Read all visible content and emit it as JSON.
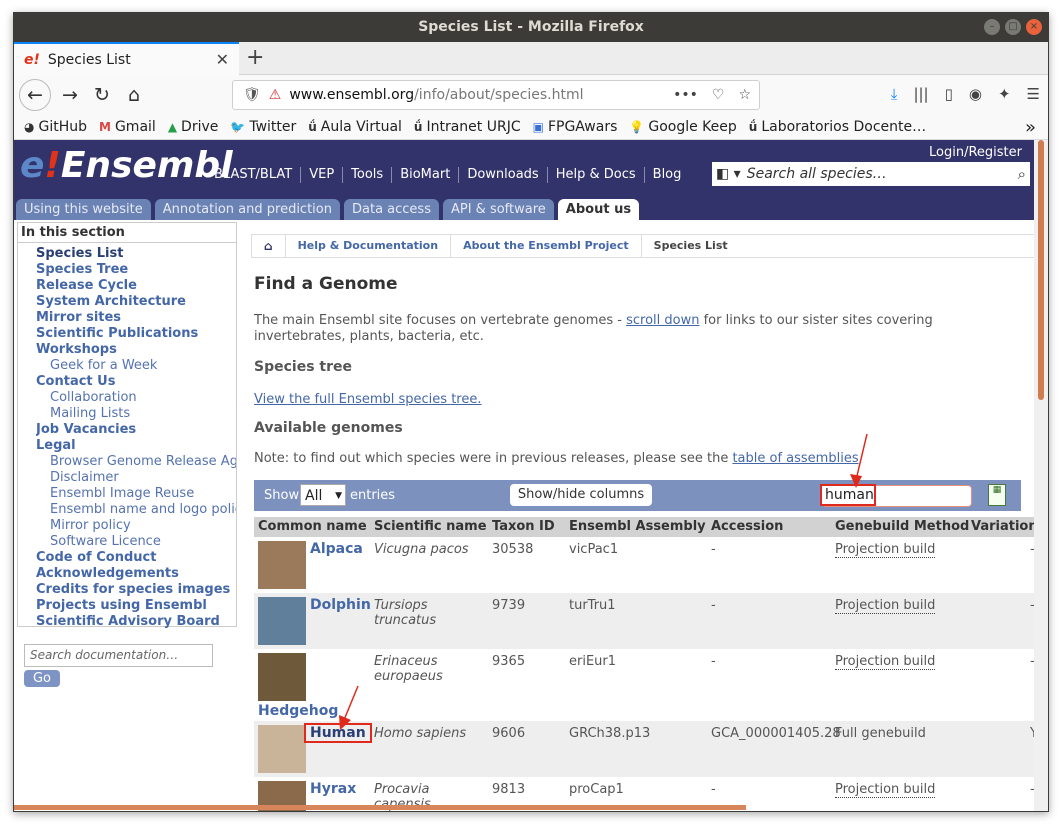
{
  "window": {
    "title": "Species List - Mozilla Firefox"
  },
  "browser": {
    "tab_title": "Species List",
    "tab_favicon": "e!",
    "url_host": "www.ensembl.org",
    "url_path": "/info/about/species.html",
    "bookmarks": [
      "GitHub",
      "Gmail",
      "Drive",
      "Twitter",
      "Aula Virtual",
      "Intranet URJC",
      "FPGAwars",
      "Google Keep",
      "Laboratorios Docente…"
    ],
    "bookmark_icons": [
      "github-icon",
      "gmail-icon",
      "drive-icon",
      "twitter-icon",
      "urjc-icon",
      "urjc-icon",
      "fpga-icon",
      "keep-icon",
      "urjc-icon"
    ]
  },
  "site": {
    "logo_e": "e",
    "logo_ex": "!",
    "logo_rest": "Ensembl",
    "login": "Login/Register",
    "nav": [
      "BLAST/BLAT",
      "VEP",
      "Tools",
      "BioMart",
      "Downloads",
      "Help & Docs",
      "Blog"
    ],
    "search_placeholder": "Search all species…",
    "section_tabs": [
      "Using this website",
      "Annotation and prediction",
      "Data access",
      "API & software",
      "About us"
    ],
    "active_tab": "About us"
  },
  "sidebar": {
    "heading": "In this section",
    "items": [
      {
        "label": "Species List",
        "level": 0
      },
      {
        "label": "Species Tree",
        "level": 0
      },
      {
        "label": "Release Cycle",
        "level": 0
      },
      {
        "label": "System Architecture",
        "level": 0
      },
      {
        "label": "Mirror sites",
        "level": 0
      },
      {
        "label": "Scientific Publications",
        "level": 0
      },
      {
        "label": "Workshops",
        "level": 0
      },
      {
        "label": "Geek for a Week",
        "level": 1
      },
      {
        "label": "Contact Us",
        "level": 0
      },
      {
        "label": "Collaboration",
        "level": 1
      },
      {
        "label": "Mailing Lists",
        "level": 1
      },
      {
        "label": "Job Vacancies",
        "level": 0
      },
      {
        "label": "Legal",
        "level": 0
      },
      {
        "label": "Browser Genome Release Agreement",
        "level": 1
      },
      {
        "label": "Disclaimer",
        "level": 1
      },
      {
        "label": "Ensembl Image Reuse",
        "level": 1
      },
      {
        "label": "Ensembl name and logo policy",
        "level": 1
      },
      {
        "label": "Mirror policy",
        "level": 1
      },
      {
        "label": "Software Licence",
        "level": 1
      },
      {
        "label": "Code of Conduct",
        "level": 0
      },
      {
        "label": "Acknowledgements",
        "level": 0
      },
      {
        "label": "Credits for species images",
        "level": 0
      },
      {
        "label": "Projects using Ensembl",
        "level": 0
      },
      {
        "label": "Scientific Advisory Board",
        "level": 0
      }
    ],
    "doc_search_placeholder": "Search documentation…",
    "go_label": "Go"
  },
  "breadcrumb": [
    "Help & Documentation",
    "About the Ensembl Project",
    "Species List"
  ],
  "content": {
    "title": "Find a Genome",
    "intro_before": "The main Ensembl site focuses on vertebrate genomes - ",
    "intro_link": "scroll down",
    "intro_after": " for links to our sister sites covering invertebrates, plants, bacteria, etc.",
    "species_tree_heading": "Species tree",
    "species_tree_link": "View the full Ensembl species tree.",
    "available_heading": "Available genomes",
    "note_before": "Note: to find out which species were in previous releases, please see the ",
    "note_link": "table of assemblies"
  },
  "table": {
    "show_label": "Show",
    "show_value": "All",
    "entries_label": "entries",
    "toggle_columns": "Show/hide columns",
    "filter_value": "human",
    "columns": [
      "Common name",
      "Scientific name",
      "Taxon ID",
      "Ensembl Assembly",
      "Accession",
      "Genebuild Method",
      "Variation d"
    ],
    "rows": [
      {
        "common": "Alpaca",
        "scientific": "Vicugna pacos",
        "taxon": "30538",
        "assembly": "vicPac1",
        "accession": "-",
        "method": "Projection build",
        "variation": "-"
      },
      {
        "common": "Dolphin",
        "scientific": "Tursiops truncatus",
        "taxon": "9739",
        "assembly": "turTru1",
        "accession": "-",
        "method": "Projection build",
        "variation": "-"
      },
      {
        "common": "Hedgehog",
        "scientific": "Erinaceus europaeus",
        "taxon": "9365",
        "assembly": "eriEur1",
        "accession": "-",
        "method": "Projection build",
        "variation": "-"
      },
      {
        "common": "Human",
        "scientific": "Homo sapiens",
        "taxon": "9606",
        "assembly": "GRCh38.p13",
        "accession": "GCA_000001405.28",
        "method": "Full genebuild",
        "variation": "Y"
      },
      {
        "common": "Hyrax",
        "scientific": "Procavia capensis",
        "taxon": "9813",
        "assembly": "proCap1",
        "accession": "-",
        "method": "Projection build",
        "variation": "-"
      }
    ]
  }
}
